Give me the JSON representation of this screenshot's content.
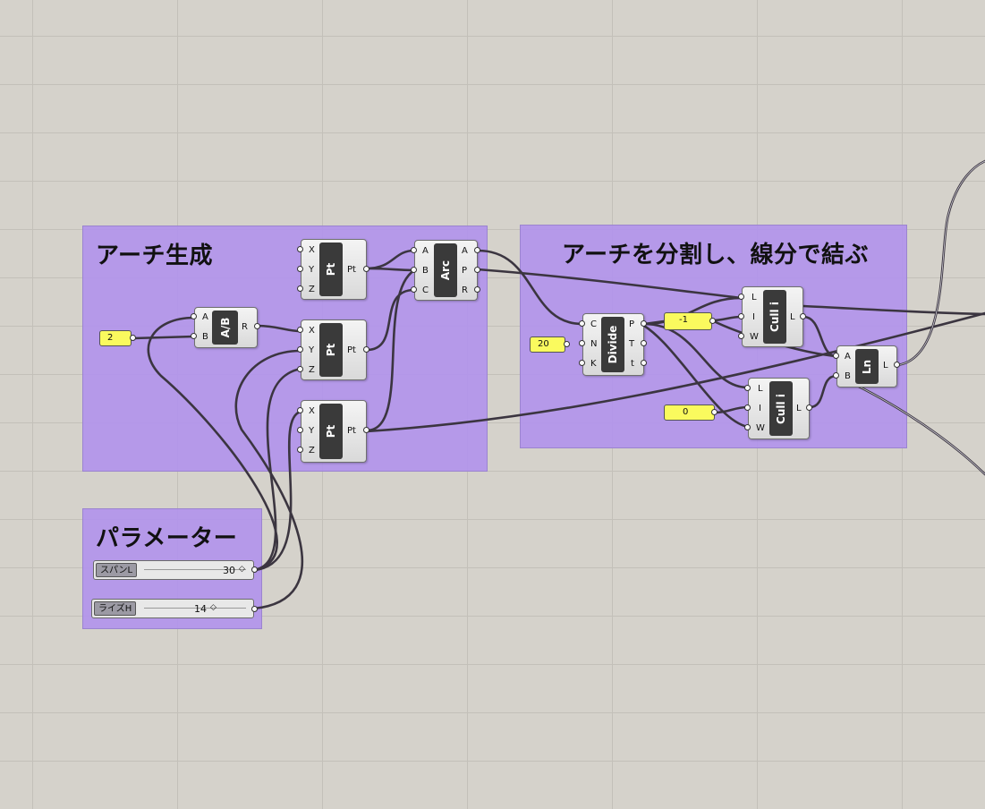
{
  "groups": {
    "arch": {
      "title": "アーチ生成"
    },
    "divide": {
      "title": "アーチを分割し、線分で結ぶ"
    },
    "params": {
      "title": "パラメーター"
    }
  },
  "components": {
    "pt1": {
      "label": "Pt",
      "inputs": [
        "X",
        "Y",
        "Z"
      ],
      "outputs": [
        "Pt"
      ]
    },
    "pt2": {
      "label": "Pt",
      "inputs": [
        "X",
        "Y",
        "Z"
      ],
      "outputs": [
        "Pt"
      ]
    },
    "pt3": {
      "label": "Pt",
      "inputs": [
        "X",
        "Y",
        "Z"
      ],
      "outputs": [
        "Pt"
      ]
    },
    "div": {
      "label": "A/B",
      "inputs": [
        "A",
        "B"
      ],
      "outputs": [
        "R"
      ]
    },
    "arc": {
      "label": "Arc",
      "inputs": [
        "A",
        "B",
        "C"
      ],
      "outputs": [
        "A",
        "P",
        "R"
      ]
    },
    "divide": {
      "label": "Divide",
      "inputs": [
        "C",
        "N",
        "K"
      ],
      "outputs": [
        "P",
        "T",
        "t"
      ]
    },
    "cull1": {
      "label": "Cull i",
      "inputs": [
        "L",
        "I",
        "W"
      ],
      "outputs": [
        "L"
      ]
    },
    "cull2": {
      "label": "Cull i",
      "inputs": [
        "L",
        "I",
        "W"
      ],
      "outputs": [
        "L"
      ]
    },
    "ln": {
      "label": "Ln",
      "inputs": [
        "A",
        "B"
      ],
      "outputs": [
        "L"
      ]
    }
  },
  "panels": {
    "two": "2",
    "twenty": "20",
    "neg_one": "-1",
    "zero": "0"
  },
  "sliders": {
    "span": {
      "label": "スパンL",
      "value": "30"
    },
    "rise": {
      "label": "ライズH",
      "value": "14"
    }
  }
}
